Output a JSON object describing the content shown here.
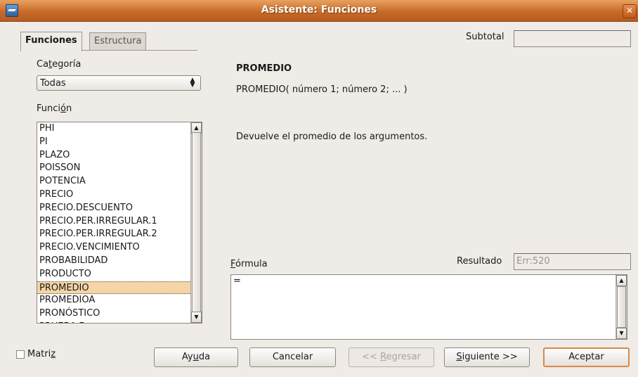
{
  "window": {
    "title": "Asistente: Funciones",
    "close_symbol": "✕",
    "app_icon": "openoffice-icon"
  },
  "tabs": [
    {
      "label": "Funciones",
      "active": true
    },
    {
      "label": "Estructura",
      "active": false
    }
  ],
  "left": {
    "category_label_pre": "Ca",
    "category_label_u": "t",
    "category_label_post": "egoría",
    "category_value": "Todas",
    "function_label_pre": "Funci",
    "function_label_u": "ó",
    "function_label_post": "n",
    "functions": [
      "PHI",
      "PI",
      "PLAZO",
      "POISSON",
      "POTENCIA",
      "PRECIO",
      "PRECIO.DESCUENTO",
      "PRECIO.PER.IRREGULAR.1",
      "PRECIO.PER.IRREGULAR.2",
      "PRECIO.VENCIMIENTO",
      "PROBABILIDAD",
      "PRODUCTO",
      "PROMEDIO",
      "PROMEDIOA",
      "PRONÓSTICO",
      "PRUEBA.F"
    ],
    "selected_function": "PROMEDIO"
  },
  "right": {
    "subtotal_label": "Subtotal",
    "subtotal_value": "",
    "function_name": "PROMEDIO",
    "function_syntax": "PROMEDIO( número 1; número 2; ...  )",
    "function_description": "Devuelve el promedio de los argumentos.",
    "result_label": "Resultado",
    "result_value": "Err:520",
    "formula_label_u": "F",
    "formula_label_post": "órmula",
    "formula_value": "="
  },
  "footer": {
    "array_label_pre": "Matri",
    "array_label_u": "z",
    "array_checked": false,
    "help_pre": "Ay",
    "help_u": "u",
    "help_post": "da",
    "cancel": "Cancelar",
    "back_pre": "<< ",
    "back_u": "R",
    "back_post": "egresar",
    "next_u": "S",
    "next_post": "iguiente >>",
    "ok": "Aceptar"
  }
}
